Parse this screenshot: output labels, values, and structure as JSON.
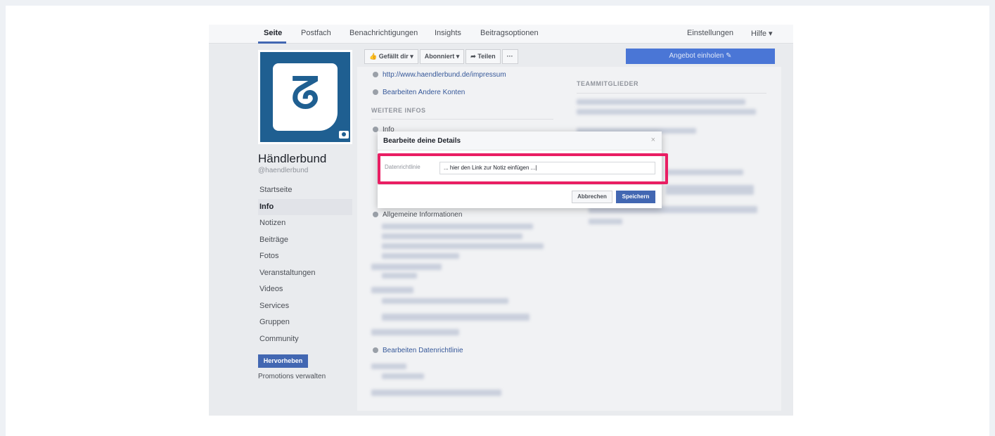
{
  "topnav": {
    "tabs": [
      "Seite",
      "Postfach",
      "Benachrichtigungen",
      "Insights",
      "Beitragsoptionen"
    ],
    "right": [
      "Einstellungen",
      "Hilfe ▾"
    ]
  },
  "page": {
    "name": "Händlerbund",
    "handle": "@haendlerbund"
  },
  "sidenav": {
    "items": [
      "Startseite",
      "Info",
      "Notizen",
      "Beiträge",
      "Fotos",
      "Veranstaltungen",
      "Videos",
      "Services",
      "Gruppen",
      "Community"
    ],
    "active": "Info"
  },
  "boost_button": "Hervorheben",
  "promo_link": "Promotions verwalten",
  "action_bar": {
    "liked": "👍 Gefällt dir ▾",
    "following": "Abonniert ▾",
    "share": "➦ Teilen",
    "more": "···"
  },
  "offer_button": "Angebot einholen ✎",
  "content": {
    "impressum_link": "http://www.haendlerbund.de/impressum",
    "edit_accounts": "Bearbeiten Andere Konten",
    "more_info_heading": "WEITERE INFOS",
    "info_label": "Info",
    "general_info": "Allgemeine Informationen",
    "edit_privacy": "Bearbeiten Datenrichtlinie",
    "team_heading": "TEAMMITGLIEDER"
  },
  "dialog": {
    "title": "Bearbeite deine Details",
    "close": "×",
    "field_label": "Datenrichtlinie",
    "field_value": "... hier den Link zur Notiz einfügen ...|",
    "cancel": "Abbrechen",
    "save": "Speichern"
  },
  "colors": {
    "highlight": "#e91e63",
    "brand_blue": "#4267b2",
    "logo_blue": "#1f5f91"
  }
}
